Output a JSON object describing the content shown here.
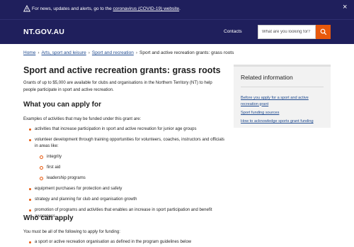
{
  "alert": {
    "text_prefix": "For news, updates and alerts, go to the ",
    "link_text": "coronavirus (COVID-19) website",
    "text_suffix": ".",
    "close": "×"
  },
  "header": {
    "logo": "NT.GOV.AU",
    "contacts": "Contacts",
    "search_placeholder": "What are you looking for?"
  },
  "breadcrumb": [
    {
      "label": "Home",
      "link": true
    },
    {
      "label": "Arts, sport and leisure",
      "link": true
    },
    {
      "label": "Sport and recreation",
      "link": true
    },
    {
      "label": "Sport and active recreation grants: grass roots",
      "link": false
    }
  ],
  "main": {
    "title": "Sport and active recreation grants: grass roots",
    "intro": "Grants of up to $5,000 are available for clubs and organisations in the Northern Territory (NT) to help people participate in sport and active recreation.",
    "what_heading": "What you can apply for",
    "examples_text": "Examples of activities that may be funded under this grant are:",
    "activities": [
      "activities that increase participation in sport and active recreation for junior age groups",
      "volunteer development through training opportunities for volunteers, coaches, instructors and officials in areas like:",
      "equipment purchases for protection and safety",
      "strategy and planning for club and organisation growth",
      "promotion of programs and activities that enables an increase in sport participation and benefit awareness."
    ],
    "volunteer_areas": [
      "integrity",
      "first aid",
      "leadership programs"
    ],
    "who_heading": "Who can apply",
    "must_text": "You must be all of the following to apply for funding:",
    "must_items": [
      "a sport or active recreation organisation as defined in the program guidelines below"
    ]
  },
  "sidebar": {
    "title": "Related information",
    "links": [
      "Before you apply for a sport and active recreation grant",
      "Sport funding sources",
      "How to acknowledge sports grant funding"
    ]
  },
  "colors": {
    "navy": "#1f1f5c",
    "accent_orange": "#e8590c",
    "link_blue": "#1f4a8f",
    "sidebar_bg": "#f2f2f2"
  },
  "icons": [
    "warning-icon",
    "close-icon",
    "search-icon"
  ]
}
